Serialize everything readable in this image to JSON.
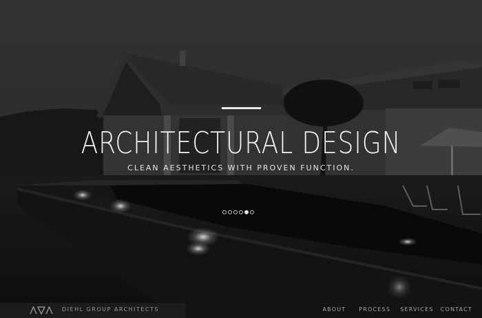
{
  "hero": {
    "title": "ARCHITECTURAL DESIGN",
    "subtitle": "CLEAN AESTHETICS WITH PROVEN FUNCTION.",
    "slides": {
      "count": 6,
      "active_index": 4
    }
  },
  "brand": {
    "logo_icon": "triangle-logo-icon",
    "name": "DIEHL GROUP ARCHITECTS"
  },
  "nav": {
    "items": [
      {
        "label": "ABOUT"
      },
      {
        "label": "PROCESS"
      },
      {
        "label": "SERVICES"
      },
      {
        "label": "CONTACT"
      }
    ]
  }
}
